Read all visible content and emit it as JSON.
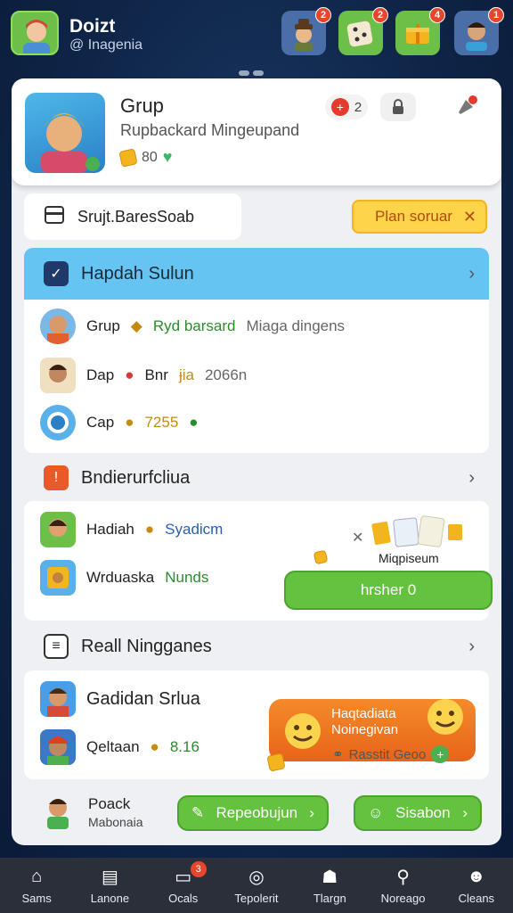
{
  "user": {
    "name": "Doizt",
    "handle": "@ Inagenia"
  },
  "top_icons": [
    {
      "name": "hat-man-icon",
      "badge": "2",
      "bg": "#4a6fa8"
    },
    {
      "name": "dice-icon",
      "badge": "2",
      "bg": "#6cc04a"
    },
    {
      "name": "gift-icon",
      "badge": "4",
      "bg": "#6cc04a"
    },
    {
      "name": "avatar-icon",
      "badge": "1",
      "bg": "#4a6fa8"
    }
  ],
  "group": {
    "title": "Grup",
    "subtitle": "Rupbackard Mingeupand",
    "coins": "80",
    "count": "2"
  },
  "search": {
    "value": "Srujt.BaresSoab"
  },
  "plan_button": {
    "label": "Plan soruar"
  },
  "section1": {
    "title": "Hapdah Sulun",
    "rows": [
      {
        "a": "Grup",
        "b": "Ryd barsard",
        "c": "Miaga dingens"
      },
      {
        "a": "Dap",
        "b": "Bnr",
        "c": "ɉia",
        "d": "2066n"
      },
      {
        "a": "Cap",
        "b": "7255"
      }
    ]
  },
  "section2": {
    "title": "Bndierurfcliua",
    "rows": [
      {
        "a": "Hadiah",
        "b": "Syadicm"
      },
      {
        "a": "Wrduaska",
        "b": "Nunds"
      }
    ],
    "promo_label": "Miqpiseum",
    "button": "hrsher 0"
  },
  "section3": {
    "title": "Reall Ningganes",
    "rows": [
      {
        "a": "Gadidan Srlua"
      },
      {
        "a": "Qeltaan",
        "b": "8.16"
      }
    ],
    "promo": {
      "line1": "Haqtadiata",
      "line2": "Noinegivan",
      "line3": "Rasstit Geoo"
    }
  },
  "footer": {
    "name": "Poack",
    "sub": "Mabonaia",
    "btn1": "Repeobujun",
    "btn2": "Sisabon"
  },
  "nav": [
    {
      "label": "Sams",
      "icon": "home-icon"
    },
    {
      "label": "Lanone",
      "icon": "document-icon"
    },
    {
      "label": "Ocals",
      "icon": "chat-icon",
      "badge": "3"
    },
    {
      "label": "Tepolerit",
      "icon": "target-icon"
    },
    {
      "label": "Tlargn",
      "icon": "group-icon"
    },
    {
      "label": "Noreago",
      "icon": "search-icon"
    },
    {
      "label": "Cleans",
      "icon": "profile-icon"
    }
  ]
}
